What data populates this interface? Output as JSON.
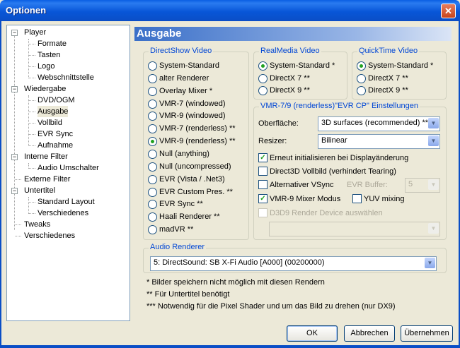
{
  "window": {
    "title": "Optionen",
    "close_glyph": "✕"
  },
  "tree": {
    "items": [
      {
        "label": "Player",
        "level": 0
      },
      {
        "label": "Formate",
        "level": 1
      },
      {
        "label": "Tasten",
        "level": 1
      },
      {
        "label": "Logo",
        "level": 1
      },
      {
        "label": "Webschnittstelle",
        "level": 1
      },
      {
        "label": "Wiedergabe",
        "level": 0
      },
      {
        "label": "DVD/OGM",
        "level": 1
      },
      {
        "label": "Ausgabe",
        "level": 1,
        "selected": true
      },
      {
        "label": "Vollbild",
        "level": 1
      },
      {
        "label": "EVR Sync",
        "level": 1
      },
      {
        "label": "Aufnahme",
        "level": 1
      },
      {
        "label": "Interne Filter",
        "level": 0
      },
      {
        "label": "Audio Umschalter",
        "level": 1
      },
      {
        "label": "Externe Filter",
        "level": 0
      },
      {
        "label": "Untertitel",
        "level": 0
      },
      {
        "label": "Standard Layout",
        "level": 1
      },
      {
        "label": "Verschiedenes",
        "level": 1
      },
      {
        "label": "Tweaks",
        "level": 0
      },
      {
        "label": "Verschiedenes",
        "level": 0
      }
    ]
  },
  "page_title": "Ausgabe",
  "directshow": {
    "title": "DirectShow Video",
    "selected_index": 6,
    "options": [
      "System-Standard",
      "alter Renderer",
      "Overlay Mixer *",
      "VMR-7 (windowed)",
      "VMR-9 (windowed)",
      "VMR-7 (renderless) **",
      "VMR-9 (renderless) **",
      "Null (anything)",
      "Null (uncompressed)",
      "EVR (Vista / .Net3)",
      "EVR Custom Pres. **",
      "EVR Sync **",
      "Haali Renderer **",
      "madVR **"
    ]
  },
  "realmedia": {
    "title": "RealMedia Video",
    "selected_index": 0,
    "options": [
      "System-Standard *",
      "DirectX 7 **",
      "DirectX 9 **"
    ]
  },
  "quicktime": {
    "title": "QuickTime Video",
    "selected_index": 0,
    "options": [
      "System-Standard *",
      "DirectX 7 **",
      "DirectX 9 **"
    ]
  },
  "vmr": {
    "title": "VMR-7/9 (renderless)\"EVR CP\" Einstellungen",
    "surface_label": "Oberfläche:",
    "surface_value": "3D surfaces (recommended) **",
    "resizer_label": "Resizer:",
    "resizer_value": "Bilinear",
    "reinit": "Erneut initialisieren bei Displayänderung",
    "d3d_fullscreen": "Direct3D Vollbild (verhindert Tearing)",
    "alt_vsync": "Alternativer VSync",
    "evr_buffer_label": "EVR Buffer:",
    "evr_buffer_value": "5",
    "vmr9_mixer": "VMR-9 Mixer Modus",
    "yuv_mixing": "YUV mixing",
    "d3d9_device": "D3D9 Render Device auswählen",
    "device_value": ""
  },
  "audio": {
    "title": "Audio Renderer",
    "value": "5: DirectSound: SB X-Fi Audio [A000] (00200000)"
  },
  "notes": [
    "* Bilder speichern nicht möglich mit diesen Rendern",
    "** Für Untertitel benötigt",
    "*** Notwendig für die Pixel Shader und um das Bild zu drehen (nur DX9)"
  ],
  "buttons": {
    "ok": "OK",
    "cancel": "Abbrechen",
    "apply": "Übernehmen"
  },
  "colors": {
    "accent": "#0a5fe3",
    "group_title": "#0046d5",
    "check": "#21a121"
  }
}
